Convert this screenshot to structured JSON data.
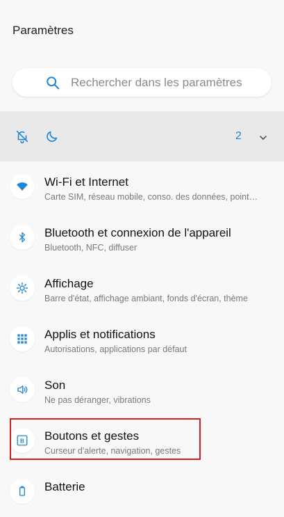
{
  "header": {
    "title": "Paramètres"
  },
  "search": {
    "placeholder": "Rechercher dans les paramètres"
  },
  "quick_bar": {
    "notification_count": "2"
  },
  "settings": [
    {
      "icon": "wifi-icon",
      "title": "Wi-Fi et Internet",
      "subtitle": "Carte SIM, réseau mobile, conso. des données, point…"
    },
    {
      "icon": "bluetooth-icon",
      "title": "Bluetooth et connexion de l'appareil",
      "subtitle": "Bluetooth, NFC, diffuser"
    },
    {
      "icon": "brightness-icon",
      "title": "Affichage",
      "subtitle": "Barre d'état, affichage ambiant, fonds d'écran, thème"
    },
    {
      "icon": "apps-grid-icon",
      "title": "Applis et notifications",
      "subtitle": "Autorisations, applications par défaut"
    },
    {
      "icon": "volume-icon",
      "title": "Son",
      "subtitle": "Ne pas déranger, vibrations"
    },
    {
      "icon": "buttons-gestures-icon",
      "title": "Boutons et gestes",
      "subtitle": "Curseur d'alerte, navigation, gestes"
    },
    {
      "icon": "battery-icon",
      "title": "Batterie",
      "subtitle": ""
    }
  ],
  "colors": {
    "accent": "#1f87d6",
    "highlight": "#d21f1f",
    "background": "#f8f8f8"
  }
}
